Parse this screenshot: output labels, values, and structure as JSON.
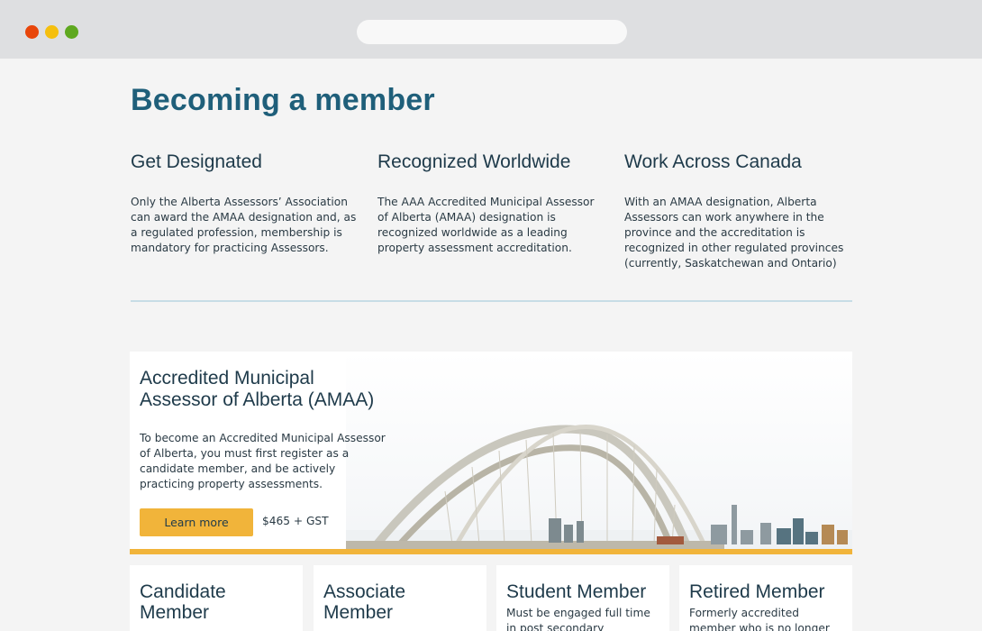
{
  "browser": {
    "address": ""
  },
  "page": {
    "title": "Becoming a member"
  },
  "features": [
    {
      "heading": "Get Designated",
      "text": "Only the Alberta Assessors’ Association can award the AMAA designation and, as a regulated profession, membership is mandatory for practicing Assessors."
    },
    {
      "heading": "Recognized Worldwide",
      "text": "The AAA Accredited Municipal Assessor of Alberta (AMAA) designation is recognized worldwide as a leading property assessment accreditation."
    },
    {
      "heading": "Work Across Canada",
      "text": "With an AMAA designation, Alberta Assessors can work anywhere in the province and the accreditation is recognized in other regulated provinces (currently, Saskatchewan and Ontario)"
    }
  ],
  "hero": {
    "heading": "Accredited Municipal Assessor of Alberta (AMAA)",
    "text": "To become an Accredited Municipal Assessor of Alberta, you must first register as a candidate member, and be actively practicing property assessments.",
    "button_label": "Learn more",
    "price": "$465 + GST",
    "image_icon": "bridge-skyline-image"
  },
  "cards": [
    {
      "heading": "Candidate Member",
      "text": ""
    },
    {
      "heading": "Associate Member",
      "text": ""
    },
    {
      "heading": "Student Member",
      "text": "Must be engaged full time in post secondary educational"
    },
    {
      "heading": "Retired Member",
      "text": "Formerly accredited member who is no longer"
    }
  ],
  "colors": {
    "accent": "#f1b43a",
    "title": "#1f5f7a",
    "divider": "#c7dde6"
  }
}
